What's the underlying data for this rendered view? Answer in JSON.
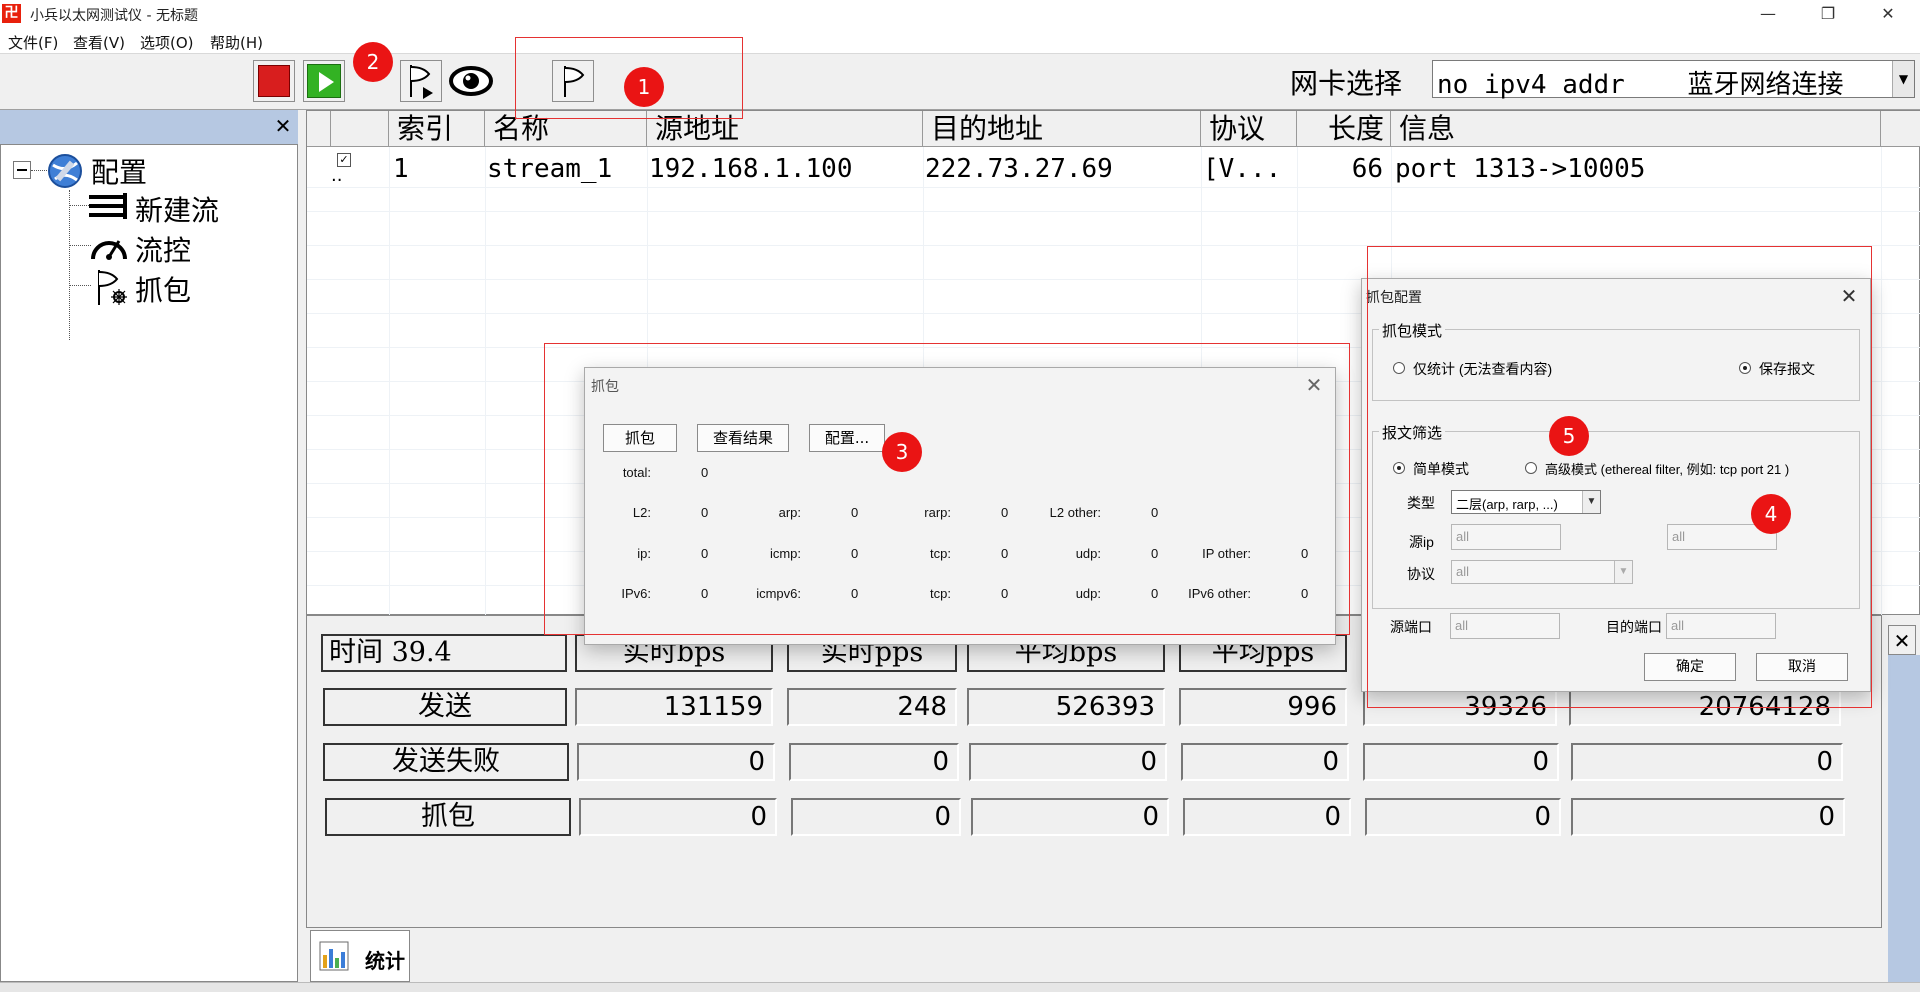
{
  "window": {
    "title": "小兵以太网测试仪 - 无标题",
    "icon_glyph": "卍",
    "minimize_glyph": "—",
    "restore_glyph": "❐",
    "close_glyph": "✕"
  },
  "menu": [
    "文件(F)",
    "查看(V)",
    "选项(O)",
    "帮助(H)"
  ],
  "toolbar": {
    "nic_label": "网卡选择",
    "nic_value": "no ipv4 addr    蓝牙网络连接",
    "dropdown_glyph": "▼"
  },
  "badges": {
    "b1": "1",
    "b2": "2",
    "b3": "3",
    "b4": "4",
    "b5": "5"
  },
  "tree": {
    "close_glyph": "✕",
    "root": "配置",
    "items": [
      "新建流",
      "流控",
      "抓包"
    ]
  },
  "table": {
    "headers": [
      "索引",
      "名称",
      "源地址",
      "目的地址",
      "协议",
      "长度",
      "信息"
    ],
    "row": {
      "index": "1",
      "name": "stream_1",
      "src": "192.168.1.100",
      "dst": "222.73.27.69",
      "proto": "[V...",
      "len": "66",
      "info": "port 1313->10005"
    }
  },
  "stats": {
    "time_label": "时间 39.4",
    "headers": [
      "实时bps",
      "实时pps",
      "平均bps",
      "平均pps"
    ],
    "rows": [
      {
        "label": "发送",
        "values": [
          "131159",
          "248",
          "526393",
          "996",
          "39326",
          "20764128"
        ]
      },
      {
        "label": "发送失败",
        "values": [
          "0",
          "0",
          "0",
          "0",
          "0",
          "0"
        ]
      },
      {
        "label": "抓包",
        "values": [
          "0",
          "0",
          "0",
          "0",
          "0",
          "0"
        ]
      }
    ],
    "close_glyph": "✕"
  },
  "bottom_tab": "统计",
  "capture_dialog": {
    "title": "抓包",
    "close_glyph": "✕",
    "buttons": [
      "抓包",
      "查看结果",
      "配置..."
    ],
    "total_label": "total:",
    "total_value": "0",
    "rows": [
      [
        [
          "L2:",
          "0"
        ],
        [
          "arp:",
          "0"
        ],
        [
          "rarp:",
          "0"
        ],
        [
          "L2 other:",
          "0"
        ]
      ],
      [
        [
          "ip:",
          "0"
        ],
        [
          "icmp:",
          "0"
        ],
        [
          "tcp:",
          "0"
        ],
        [
          "udp:",
          "0"
        ],
        [
          "IP other:",
          "0"
        ]
      ],
      [
        [
          "IPv6:",
          "0"
        ],
        [
          "icmpv6:",
          "0"
        ],
        [
          "tcp:",
          "0"
        ],
        [
          "udp:",
          "0"
        ],
        [
          "IPv6 other:",
          "0"
        ]
      ]
    ]
  },
  "config_dialog": {
    "title": "抓包配置",
    "close_glyph": "✕",
    "mode_group": "抓包模式",
    "mode_stats_only": "仅统计 (无法查看内容)",
    "mode_save": "保存报文",
    "filter_group": "报文筛选",
    "simple_mode": "简单模式",
    "advanced_mode": "高级模式 (ethereal filter, 例如: tcp port 21 )",
    "type_label": "类型",
    "type_value": "二层(arp, rarp, ...)",
    "src_ip_label": "源ip",
    "src_ip_value": "all",
    "dst_ip_value": "all",
    "proto_label": "协议",
    "proto_value": "all",
    "src_port_label": "源端口",
    "src_port_value": "all",
    "dst_port_label": "目的端口",
    "dst_port_value": "all",
    "ok": "确定",
    "cancel": "取消",
    "combo_arrow": "▼"
  }
}
